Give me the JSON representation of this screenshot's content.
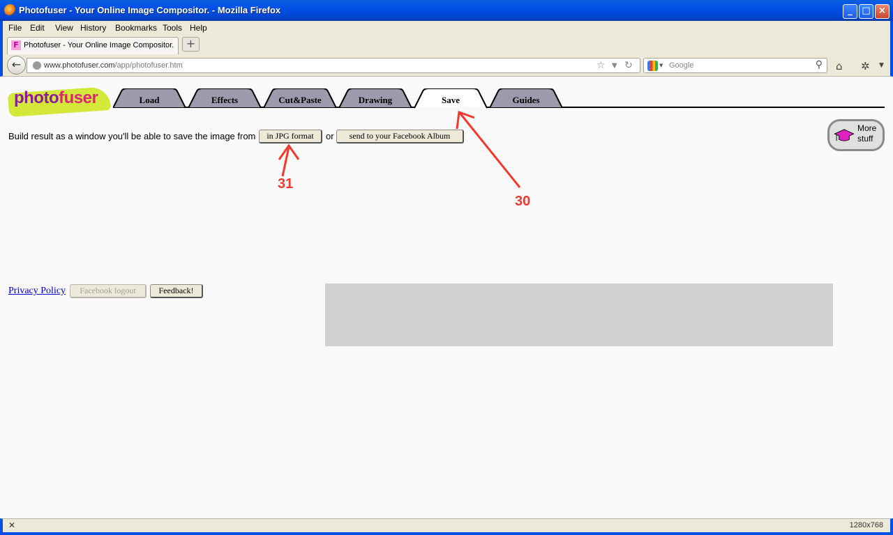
{
  "window": {
    "title": "Photofuser - Your Online Image Compositor. - Mozilla Firefox"
  },
  "menu": [
    "File",
    "Edit",
    "View",
    "History",
    "Bookmarks",
    "Tools",
    "Help"
  ],
  "browser_tab": {
    "label": "Photofuser - Your Online Image Compositor."
  },
  "address": {
    "host": "www.photofuser.com",
    "path": "/app/photofuser.htm"
  },
  "search": {
    "placeholder": "Google"
  },
  "logo": {
    "part1": "photo",
    "part2": "fuser"
  },
  "app_tabs": [
    "Load",
    "Effects",
    "Cut&Paste",
    "Drawing",
    "Save",
    "Guides"
  ],
  "active_tab": "Save",
  "save_panel": {
    "intro": "Build result as a window you'll be able to save the image from",
    "jpg_button": "in JPG format",
    "or": "or",
    "facebook_button": "send to your Facebook Album"
  },
  "more_stuff": {
    "line1": "More",
    "line2": "stuff"
  },
  "footer": {
    "privacy": "Privacy Policy",
    "fb_logout": "Facebook logout",
    "feedback": "Feedback!"
  },
  "annotations": {
    "a30": "30",
    "a31": "31"
  },
  "status": {
    "resolution": "1280x768"
  },
  "colors": {
    "accent_red": "#f03a2e",
    "tab_gray": "#9e9aad",
    "logo_green": "#d4e83a",
    "logo_purple": "#8b1a9c"
  }
}
